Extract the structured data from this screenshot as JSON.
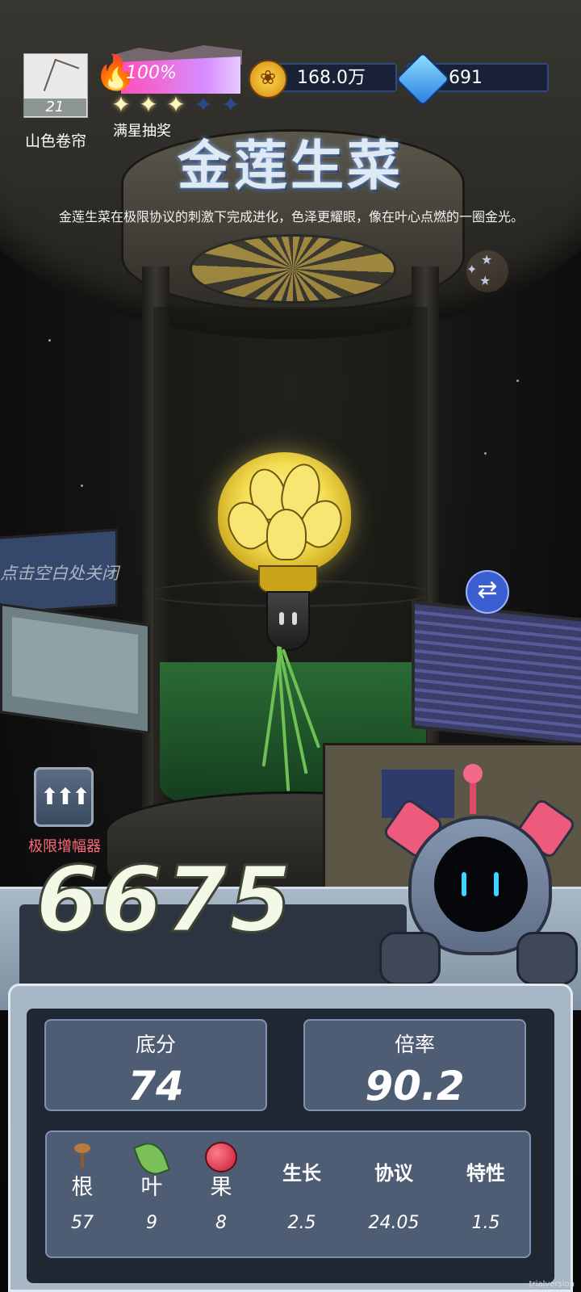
{
  "player": {
    "name": "山色卷帘",
    "level": "21"
  },
  "heat": {
    "percent": "100%",
    "stars_filled": 3,
    "stars_total": 5,
    "label": "满星抽奖"
  },
  "currency": {
    "gold": "168.0万",
    "gems": "691"
  },
  "plant": {
    "name": "金莲生菜",
    "description": "金莲生菜在极限协议的刺激下完成进化，色泽更耀眼，像在叶心点燃的一圈金光。"
  },
  "hints": {
    "close": "点击空白处关闭"
  },
  "amplifier": {
    "label": "极限增幅器"
  },
  "score": {
    "total": "6675",
    "base_label": "底分",
    "base_value": "74",
    "multiplier_label": "倍率",
    "multiplier_value": "90.2"
  },
  "details": {
    "root": {
      "label": "根",
      "value": "57",
      "icon": "sprout-root-icon"
    },
    "leaf": {
      "label": "叶",
      "value": "9",
      "icon": "leaf-icon"
    },
    "fruit": {
      "label": "果",
      "value": "8",
      "icon": "apple-icon"
    },
    "growth": {
      "label": "生长",
      "value": "2.5"
    },
    "protocol": {
      "label": "协议",
      "value": "24.05"
    },
    "trait": {
      "label": "特性",
      "value": "1.5"
    }
  },
  "watermark": "trialversion",
  "colors": {
    "accent_pink": "#ff4fb8",
    "gold": "#f3de52",
    "panel": "#4e5d74",
    "amp_label": "#ff6a78"
  }
}
